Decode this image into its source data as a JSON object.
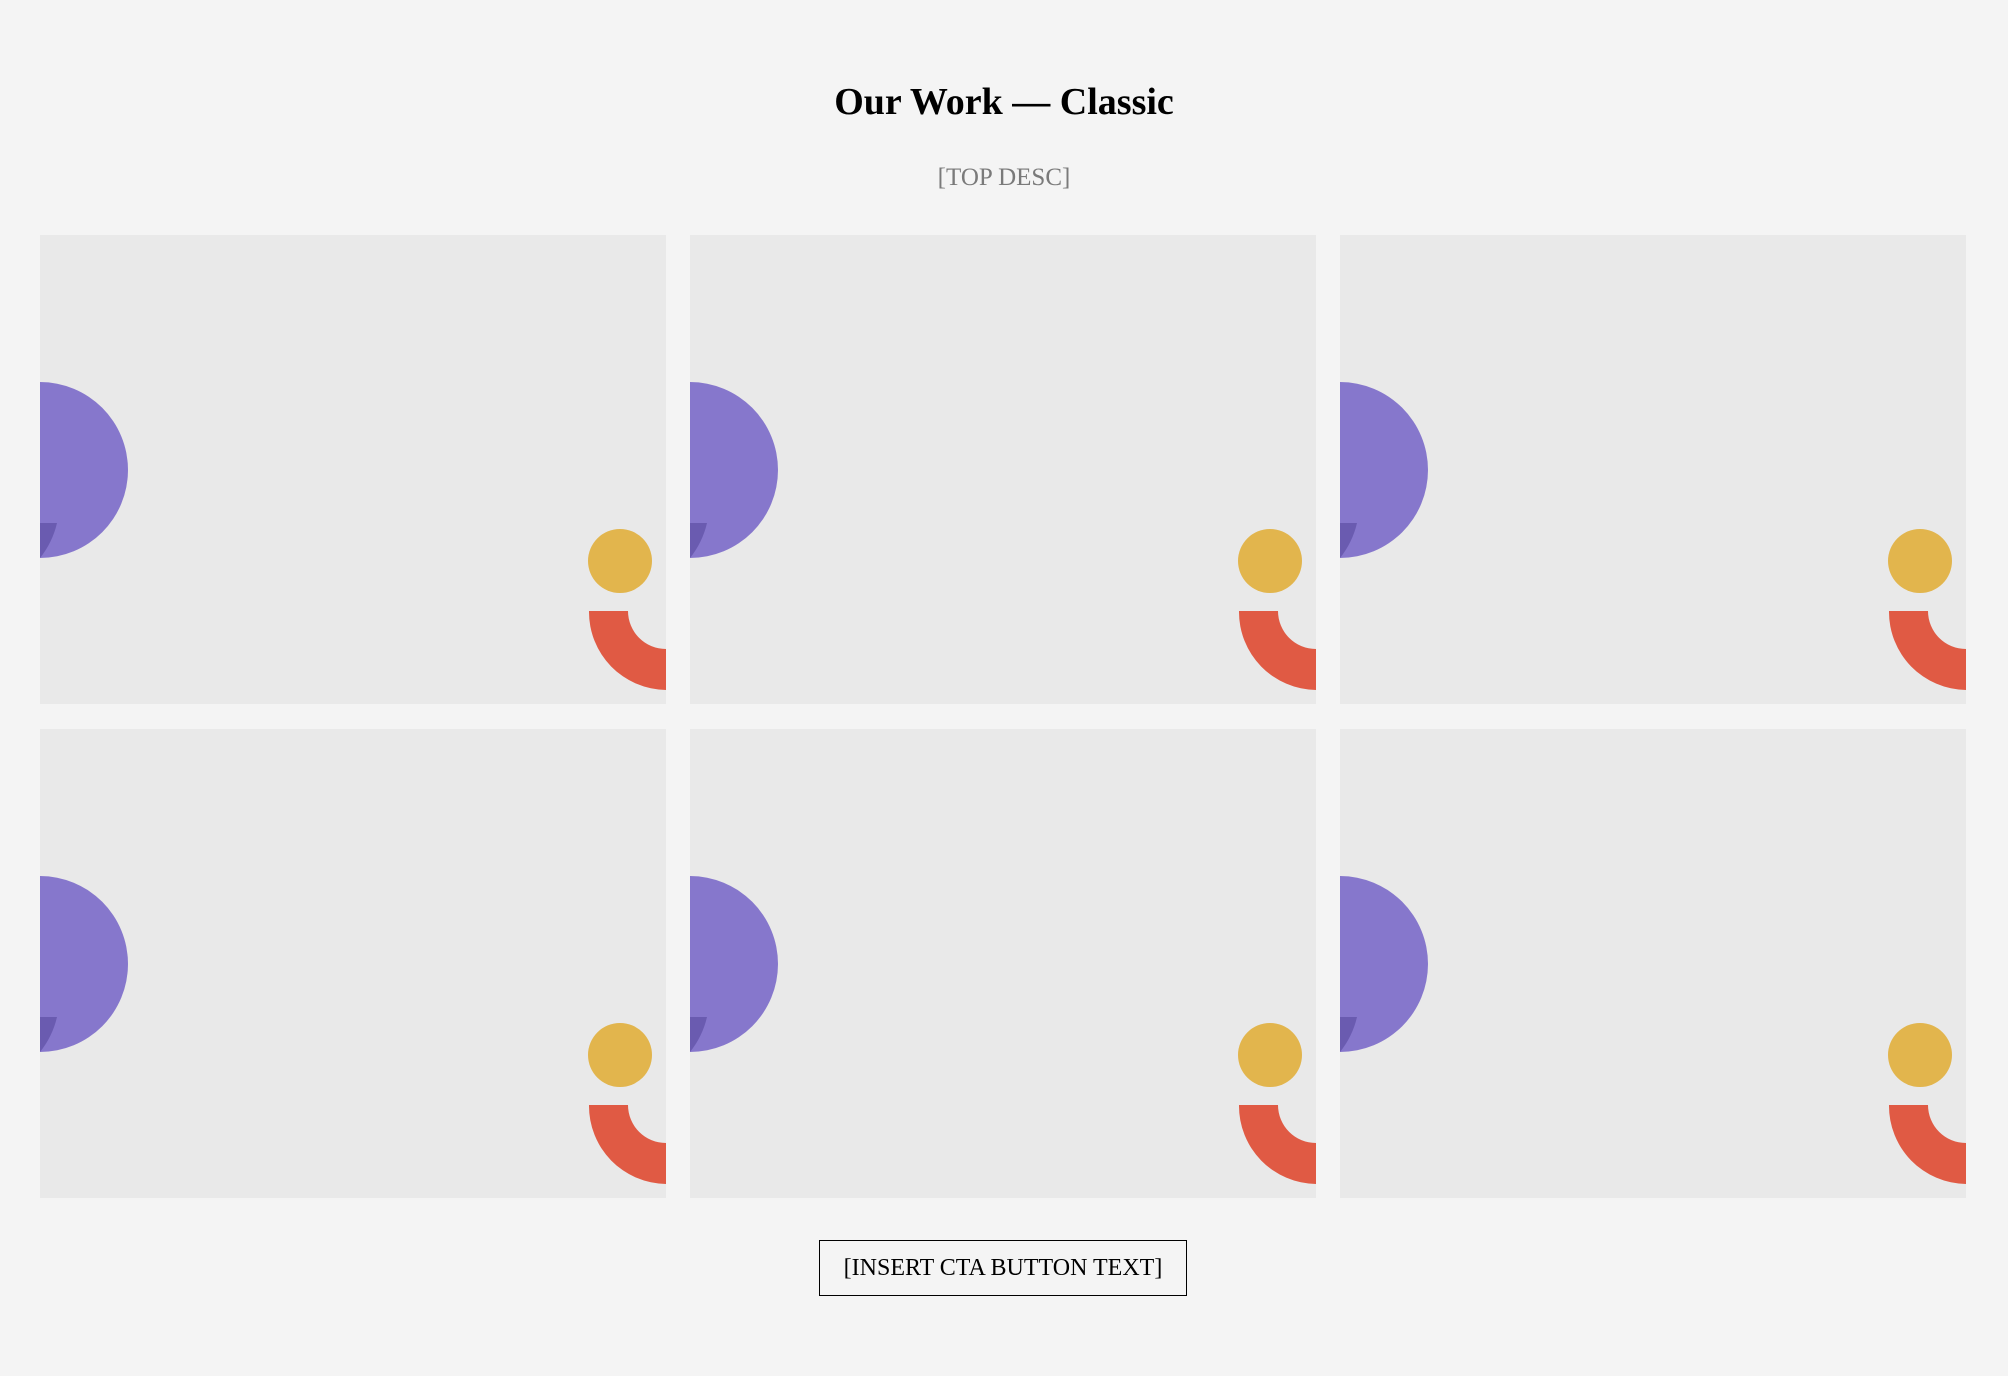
{
  "page": {
    "title": "Our Work — Classic",
    "description": "[TOP DESC]",
    "cta_label": "[INSERT CTA BUTTON TEXT]"
  },
  "colors": {
    "background": "#f4f4f4",
    "card_background": "#e9e9e9",
    "purple": "#8677cc",
    "purple_dark": "#6a5bb0",
    "yellow": "#e2b54d",
    "red": "#e05a44"
  },
  "portfolio": {
    "items": [
      {
        "placeholder_art": "abstract-shapes"
      },
      {
        "placeholder_art": "abstract-shapes"
      },
      {
        "placeholder_art": "abstract-shapes"
      },
      {
        "placeholder_art": "abstract-shapes"
      },
      {
        "placeholder_art": "abstract-shapes"
      },
      {
        "placeholder_art": "abstract-shapes"
      }
    ]
  }
}
